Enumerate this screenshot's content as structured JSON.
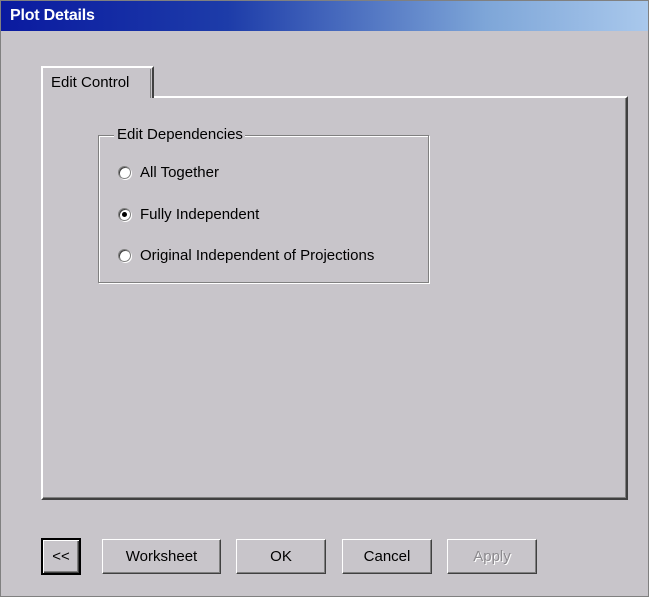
{
  "window": {
    "title": "Plot Details"
  },
  "tabs": [
    {
      "label": "Edit Control",
      "selected": true
    }
  ],
  "group": {
    "title": "Edit Dependencies",
    "options": [
      {
        "label": "All Together",
        "checked": false
      },
      {
        "label": "Fully Independent",
        "checked": true
      },
      {
        "label": "Original Independent of Projections",
        "checked": false
      }
    ]
  },
  "buttons": {
    "collapse": "<<",
    "worksheet": "Worksheet",
    "ok": "OK",
    "cancel": "Cancel",
    "apply": "Apply"
  },
  "colors": {
    "title_gradient_start": "#0a1aa0",
    "title_gradient_end": "#a9c8ec",
    "face": "#c8c5ca"
  }
}
